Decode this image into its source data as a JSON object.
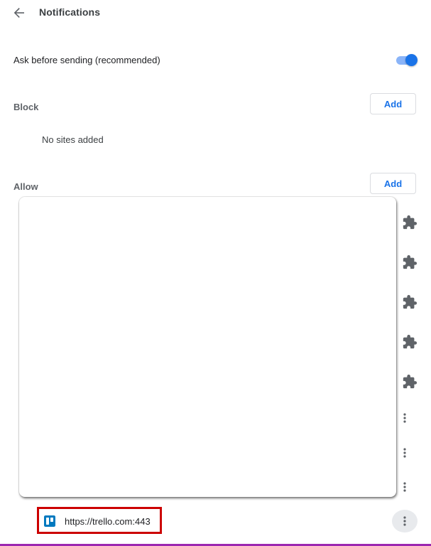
{
  "header": {
    "back_icon": "arrow-back-icon",
    "title": "Notifications"
  },
  "ask_setting": {
    "label": "Ask before sending (recommended)",
    "enabled": true,
    "accent_color": "#1a73e8"
  },
  "block": {
    "label": "Block",
    "add_label": "Add",
    "empty_text": "No sites added"
  },
  "allow": {
    "label": "Allow",
    "add_label": "Add",
    "extension_icon": "puzzle-piece-icon",
    "more_icon": "more-vert-icon",
    "site": {
      "url": "https://trello.com:443",
      "favicon": "trello-icon",
      "favicon_color": "#0079bf"
    }
  },
  "highlight_color": "#cc0000"
}
